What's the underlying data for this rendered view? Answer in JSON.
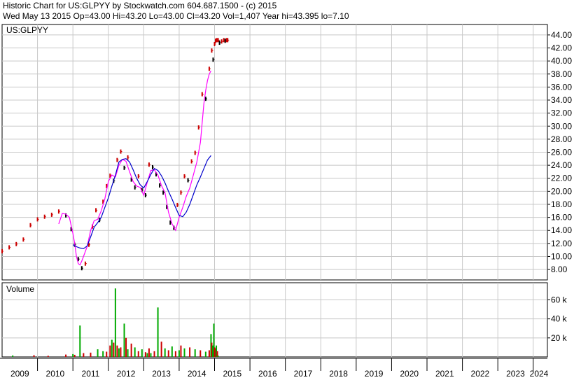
{
  "header": {
    "line1": "Historic Chart for US:GLPYY by Stockwatch.com 604.687.1500 - (c) 2015",
    "line2": "Wed May 13 2015   Op=43.00   Hi=43.20   Lo=43.00   Cl=43.20   Vol=1,407   Year hi=43.395   lo=7.10"
  },
  "chart_data": [
    {
      "type": "line",
      "title": "US:GLPYY",
      "x_axis": {
        "type": "year",
        "range": [
          2009.0,
          2024.4
        ],
        "tick_labels": [
          "2009",
          "2010",
          "2011",
          "2012",
          "2013",
          "2014",
          "2015",
          "2016",
          "2017",
          "2018",
          "2019",
          "2020",
          "2021",
          "2022",
          "2023",
          "2024"
        ]
      },
      "y_axis": {
        "range": [
          6.4,
          45.6
        ],
        "ticks": [
          8,
          10,
          12,
          14,
          16,
          18,
          20,
          22,
          24,
          26,
          28,
          30,
          32,
          34,
          36,
          38,
          40,
          42,
          44
        ],
        "tick_labels": [
          "8.00",
          "10.00",
          "12.00",
          "14.00",
          "16.00",
          "18.00",
          "20.00",
          "22.00",
          "24.00",
          "26.00",
          "28.00",
          "30.00",
          "32.00",
          "34.00",
          "36.00",
          "38.00",
          "40.00",
          "42.00",
          "44.00"
        ],
        "position": "right"
      },
      "grid": true,
      "colors": {
        "price_up": "#cc0000",
        "price_down": "#000000",
        "ma_short": "#ff00ff",
        "ma_long": "#0000cc",
        "grid": "#c8c8c8"
      },
      "series": [
        {
          "id": "price",
          "x": [
            2009.0,
            2009.2,
            2009.4,
            2009.6,
            2009.8,
            2010.0,
            2010.2,
            2010.4,
            2010.6,
            2010.8,
            2010.95,
            2011.05,
            2011.15,
            2011.25,
            2011.35,
            2011.45,
            2011.55,
            2011.65,
            2011.75,
            2011.85,
            2011.95,
            2012.05,
            2012.15,
            2012.25,
            2012.35,
            2012.45,
            2012.55,
            2012.65,
            2012.75,
            2012.85,
            2012.95,
            2013.05,
            2013.15,
            2013.25,
            2013.35,
            2013.45,
            2013.55,
            2013.65,
            2013.75,
            2013.85,
            2013.95,
            2014.05,
            2014.15,
            2014.25,
            2014.35,
            2014.45,
            2014.55,
            2014.65,
            2014.75,
            2014.85,
            2014.92,
            2014.96,
            2015.0,
            2015.03,
            2015.06,
            2015.1,
            2015.14,
            2015.2,
            2015.26,
            2015.3,
            2015.34,
            2015.37
          ],
          "values": [
            10.8,
            11.4,
            11.9,
            12.6,
            14.8,
            15.7,
            16.1,
            16.4,
            16.9,
            16.3,
            14.2,
            11.8,
            9.6,
            8.2,
            8.9,
            11.8,
            14.6,
            17.1,
            15.6,
            18.4,
            20.8,
            22.4,
            21.6,
            24.8,
            26.1,
            23.6,
            25.2,
            21.8,
            20.6,
            22.3,
            20.2,
            19.4,
            24.1,
            23.7,
            22.6,
            20.9,
            19.8,
            17.6,
            15.2,
            14.4,
            17.9,
            19.8,
            22.3,
            21.7,
            24.6,
            25.9,
            29.8,
            34.9,
            34.2,
            38.8,
            41.6,
            40.2,
            42.6,
            43.1,
            43.2,
            43.2,
            42.8,
            43.0,
            43.2,
            43.1,
            43.2,
            43.2
          ]
        },
        {
          "id": "ma_short",
          "x": [
            2010.6,
            2010.7,
            2010.8,
            2010.9,
            2011.0,
            2011.05,
            2011.1,
            2011.15,
            2011.2,
            2011.25,
            2011.3,
            2011.4,
            2011.5,
            2011.6,
            2011.7,
            2011.8,
            2011.9,
            2012.0,
            2012.1,
            2012.2,
            2012.3,
            2012.4,
            2012.5,
            2012.6,
            2012.7,
            2012.8,
            2012.9,
            2013.0,
            2013.1,
            2013.2,
            2013.3,
            2013.4,
            2013.5,
            2013.6,
            2013.7,
            2013.8,
            2013.9,
            2014.0,
            2014.1,
            2014.2,
            2014.3,
            2014.4,
            2014.5,
            2014.6,
            2014.65,
            2014.7,
            2014.75,
            2014.8,
            2014.85,
            2014.9
          ],
          "values": [
            15.0,
            16.6,
            16.5,
            16.0,
            13.5,
            12.0,
            10.0,
            8.9,
            8.7,
            9.3,
            10.0,
            11.5,
            14.0,
            15.5,
            15.7,
            17.0,
            18.8,
            21.5,
            22.5,
            22.2,
            24.0,
            24.9,
            24.6,
            23.0,
            21.5,
            20.8,
            20.6,
            19.4,
            21.4,
            23.2,
            23.3,
            22.5,
            20.9,
            19.8,
            16.8,
            15.0,
            14.0,
            16.0,
            17.5,
            19.2,
            20.5,
            22.5,
            24.5,
            27.5,
            30.5,
            33.5,
            35.5,
            37.0,
            38.0,
            38.5
          ]
        },
        {
          "id": "ma_long",
          "x": [
            2011.0,
            2011.1,
            2011.2,
            2011.3,
            2011.4,
            2011.5,
            2011.6,
            2011.7,
            2011.8,
            2011.9,
            2012.0,
            2012.1,
            2012.2,
            2012.3,
            2012.4,
            2012.5,
            2012.6,
            2012.7,
            2012.8,
            2012.9,
            2013.0,
            2013.1,
            2013.2,
            2013.3,
            2013.4,
            2013.5,
            2013.6,
            2013.7,
            2013.8,
            2013.9,
            2014.0,
            2014.1,
            2014.2,
            2014.3,
            2014.4,
            2014.5,
            2014.6,
            2014.7,
            2014.8,
            2014.9
          ],
          "values": [
            11.8,
            11.5,
            11.3,
            11.2,
            11.6,
            13.0,
            14.5,
            15.2,
            16.0,
            17.5,
            19.0,
            20.8,
            22.5,
            24.5,
            24.9,
            25.0,
            24.5,
            23.3,
            22.0,
            21.0,
            20.5,
            21.5,
            22.6,
            23.5,
            23.2,
            22.4,
            21.3,
            20.0,
            18.8,
            17.5,
            16.3,
            16.1,
            16.8,
            18.0,
            19.5,
            21.0,
            22.2,
            23.5,
            24.8,
            25.5
          ]
        }
      ]
    },
    {
      "type": "bar",
      "title": "Volume",
      "x_axis": {
        "type": "year",
        "range": [
          2009.0,
          2024.4
        ]
      },
      "y_axis": {
        "range": [
          0,
          78000
        ],
        "ticks": [
          20000,
          40000,
          60000
        ],
        "tick_labels": [
          "20 k",
          "40 k",
          "60 k"
        ],
        "position": "right"
      },
      "grid": true,
      "colors": {
        "up": "#00aa00",
        "down": "#cc0000"
      },
      "x": [
        2009.3,
        2009.9,
        2010.3,
        2010.8,
        2011.0,
        2011.05,
        2011.2,
        2011.3,
        2011.5,
        2011.7,
        2011.85,
        2011.95,
        2012.05,
        2012.1,
        2012.15,
        2012.2,
        2012.25,
        2012.3,
        2012.35,
        2012.45,
        2012.5,
        2012.55,
        2012.65,
        2012.75,
        2012.85,
        2012.95,
        2013.05,
        2013.1,
        2013.15,
        2013.2,
        2013.3,
        2013.4,
        2013.5,
        2013.6,
        2013.7,
        2013.8,
        2013.9,
        2014.0,
        2014.05,
        2014.15,
        2014.3,
        2014.45,
        2014.6,
        2014.75,
        2014.85,
        2014.9,
        2014.92,
        2014.95,
        2014.98,
        2015.0,
        2015.02,
        2015.05,
        2015.08,
        2015.1
      ],
      "values": [
        1500,
        1800,
        1200,
        2500,
        3000,
        2200,
        33000,
        4000,
        4500,
        8000,
        6000,
        5500,
        12000,
        18000,
        15000,
        72000,
        12000,
        9000,
        10000,
        35000,
        20000,
        8000,
        14000,
        10000,
        6000,
        8000,
        5000,
        4000,
        9000,
        4000,
        6000,
        52000,
        16000,
        9000,
        7000,
        11000,
        6000,
        7000,
        12000,
        9000,
        10000,
        8000,
        7000,
        5500,
        7000,
        24000,
        15000,
        12000,
        35000,
        10000,
        9000,
        12000,
        6000,
        1400
      ],
      "directions": [
        "up",
        "down",
        "down",
        "down",
        "up",
        "down",
        "up",
        "down",
        "down",
        "up",
        "up",
        "down",
        "down",
        "up",
        "down",
        "up",
        "down",
        "up",
        "down",
        "up",
        "down",
        "up",
        "down",
        "up",
        "down",
        "up",
        "down",
        "up",
        "down",
        "up",
        "down",
        "up",
        "down",
        "up",
        "down",
        "up",
        "down",
        "up",
        "down",
        "up",
        "down",
        "up",
        "down",
        "up",
        "down",
        "up",
        "down",
        "up",
        "up",
        "down",
        "down",
        "up",
        "down",
        "up"
      ]
    }
  ]
}
